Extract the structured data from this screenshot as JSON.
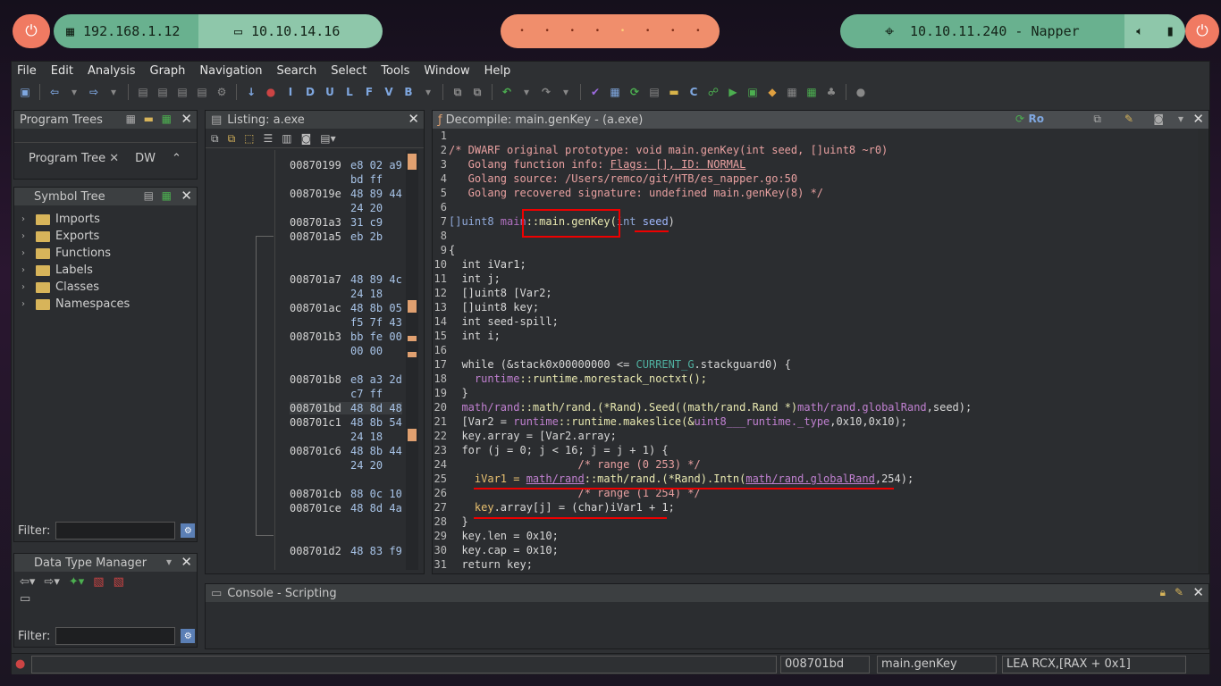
{
  "topbar": {
    "ip_local": "192.168.1.12",
    "ip_vpn": "10.10.14.16",
    "target": "10.10.11.240 - Napper",
    "workspaces": [
      "•",
      "•",
      "•",
      "•",
      "•",
      "•",
      "•",
      "•"
    ],
    "active_workspace_index": 4
  },
  "menu": [
    "File",
    "Edit",
    "Analysis",
    "Graph",
    "Navigation",
    "Search",
    "Select",
    "Tools",
    "Window",
    "Help"
  ],
  "program_trees": {
    "title": "Program Trees",
    "tab": "Program Tree",
    "tab2": "DW"
  },
  "symbol_tree": {
    "title": "Symbol Tree",
    "items": [
      "Imports",
      "Exports",
      "Functions",
      "Labels",
      "Classes",
      "Namespaces"
    ],
    "filter_label": "Filter:"
  },
  "data_type_manager": {
    "title": "Data Type Manager",
    "filter_label": "Filter:"
  },
  "listing": {
    "title": "Listing:  a.exe",
    "rows": [
      {
        "addr": "00870199",
        "bytes": "e8 02 a9"
      },
      {
        "addr": "",
        "bytes": "bd ff"
      },
      {
        "addr": "0087019e",
        "bytes": "48 89 44"
      },
      {
        "addr": "",
        "bytes": "24 20"
      },
      {
        "addr": "008701a3",
        "bytes": "31 c9"
      },
      {
        "addr": "008701a5",
        "bytes": "eb 2b"
      },
      {
        "addr": "008701a7",
        "bytes": "48 89 4c"
      },
      {
        "addr": "",
        "bytes": "24 18"
      },
      {
        "addr": "008701ac",
        "bytes": "48 8b 05"
      },
      {
        "addr": "",
        "bytes": "f5 7f 43"
      },
      {
        "addr": "008701b3",
        "bytes": "bb fe 00"
      },
      {
        "addr": "",
        "bytes": "00 00"
      },
      {
        "addr": "008701b8",
        "bytes": "e8 a3 2d"
      },
      {
        "addr": "",
        "bytes": "c7 ff"
      },
      {
        "addr": "008701bd",
        "bytes": "48 8d 48"
      },
      {
        "addr": "008701c1",
        "bytes": "48 8b 54"
      },
      {
        "addr": "",
        "bytes": "24 18"
      },
      {
        "addr": "008701c6",
        "bytes": "48 8b 44"
      },
      {
        "addr": "",
        "bytes": "24 20"
      },
      {
        "addr": "008701cb",
        "bytes": "88 0c 10"
      },
      {
        "addr": "008701ce",
        "bytes": "48 8d 4a"
      },
      {
        "addr": "008701d2",
        "bytes": "48 83 f9"
      }
    ]
  },
  "decompile": {
    "title": "Decompile: main.genKey -  (a.exe)",
    "line_numbers": [
      "1",
      "2",
      "3",
      "4",
      "5",
      "6",
      "7",
      "8",
      "9",
      "10",
      "11",
      "12",
      "13",
      "14",
      "15",
      "16",
      "17",
      "18",
      "19",
      "20",
      "21",
      "22",
      "23",
      "24",
      "25",
      "26",
      "27",
      "28",
      "29",
      "30",
      "31"
    ],
    "l2": "/* DWARF original prototype: void main.genKey(int seed, []uint8 ~r0)",
    "l3a": "   Golang function info: ",
    "l3b": "Flags: [], ID: NORMAL",
    "l4": "   Golang source: /Users/remco/git/HTB/es_napper.go:50",
    "l5": "   Golang recovered signature: undefined main.genKey(8) */",
    "l7a": "[]uint8 ",
    "l7b": "main",
    "l7c": "::main.genKey(",
    "l7d": "int ",
    "l7e": "seed",
    ")": ")",
    "l9": "{",
    "l10": "  int iVar1;",
    "l11": "  int j;",
    "l12": "  []uint8 [Var2;",
    "l13": "  []uint8 key;",
    "l14": "  int seed-spill;",
    "l15": "  int i;",
    "l17a": "  while (&stack0x00000000 <= ",
    "l17b": "CURRENT_G",
    "l17c": ".stackguard0) {",
    "l18a": "    runtime",
    "l18b": "::runtime.morestack_noctxt();",
    "l19": "  }",
    "l20a": "  math/rand",
    "l20b": "::math/rand.(*Rand).Seed((math/rand.Rand *)",
    "l20c": "math/rand.globalRand",
    "l20d": ",seed);",
    "l21a": "  [Var2 = ",
    "l21b": "runtime",
    "l21c": "::runtime.makeslice(&",
    "l21d": "uint8___runtime._type",
    "l21e": ",0x10,0x10);",
    "l22": "  key.array = [Var2.array;",
    "l23": "  for (j = 0; j < 16; j = j + 1) {",
    "l24": "                    /* range (0 253) */",
    "l25a": "    iVar1 = ",
    "l25b": "math/rand",
    "l25c": "::math/rand.(*Rand).Intn(",
    "l25d": "math/rand.globalRand",
    "l25e": ",254);",
    "l26": "                    /* range (1 254) */",
    "l27a": "    key",
    "l27b": ".array[j] = (char)iVar1 + 1;",
    "l28": "  }",
    "l29": "  key.len = 0x10;",
    "l30": "  key.cap = 0x10;",
    "l31": "  return key;"
  },
  "console": {
    "title": "Console - Scripting"
  },
  "status": {
    "addr": "008701bd",
    "func": "main.genKey",
    "instr": "LEA RCX,[RAX + 0x1]"
  }
}
